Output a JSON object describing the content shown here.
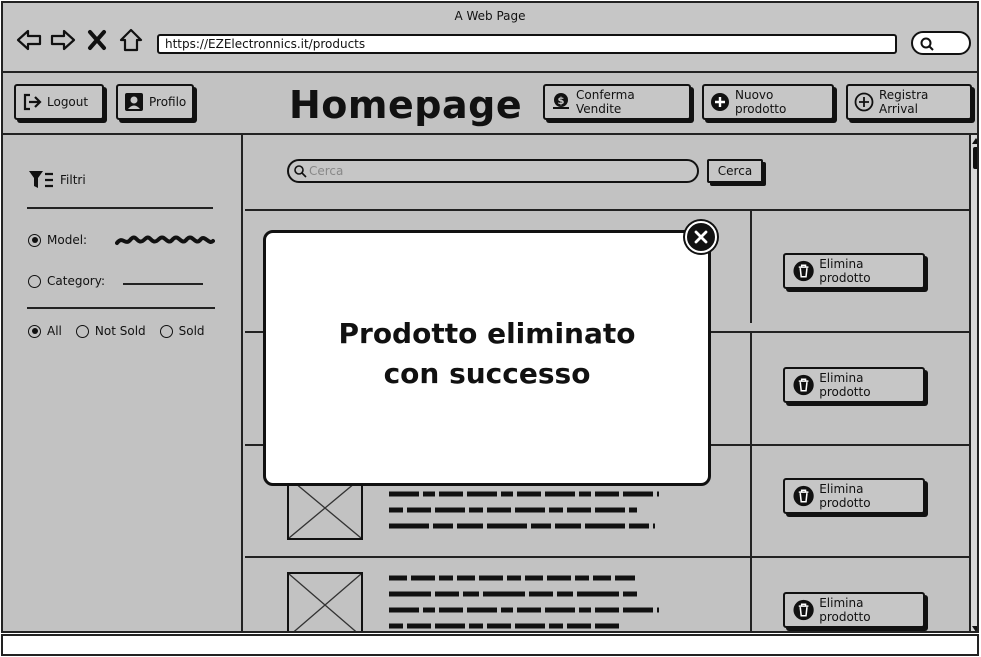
{
  "window": {
    "title": "A Web Page",
    "url": "https://EZElectronnics.it/products"
  },
  "header": {
    "logout_label": "Logout",
    "profile_label": "Profilo",
    "page_title": "Homepage",
    "confirm_sales_label": "Conferma Vendite",
    "new_product_label": "Nuovo prodotto",
    "register_arrival_label": "Registra Arrival"
  },
  "sidebar": {
    "filters_label": "Filtri",
    "model_label": "Model:",
    "category_label": "Category:",
    "sold_options": [
      {
        "label": "All",
        "selected": true
      },
      {
        "label": "Not Sold",
        "selected": false
      },
      {
        "label": "Sold",
        "selected": false
      }
    ]
  },
  "search": {
    "placeholder": "Cerca",
    "button_label": "Cerca"
  },
  "products": {
    "delete_label": "Elimina prodotto",
    "rows": [
      {
        "delete_label": "Elimina prodotto"
      },
      {
        "delete_label": "Elimina prodotto"
      },
      {
        "delete_label": "Elimina prodotto"
      },
      {
        "delete_label": "Elimina prodotto"
      }
    ]
  },
  "modal": {
    "message": "Prodotto eliminato con successo"
  },
  "icons": {
    "back": "arrow-left-icon",
    "forward": "arrow-right-icon",
    "stop": "close-icon",
    "home": "home-icon",
    "logout": "logout-icon",
    "profile": "user-icon",
    "confirm_sales": "dollar-icon",
    "new_product": "plus-icon",
    "register_arrival": "plus-circle-icon",
    "filter": "filter-icon",
    "delete": "trash-icon",
    "modal_close": "close-circle-icon"
  }
}
